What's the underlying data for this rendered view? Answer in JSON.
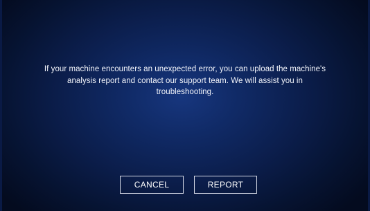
{
  "dialog": {
    "message_lines": [
      "If your machine encounters an unexpected error, you can upload the machine's",
      "analysis report and contact our support team. We will assist you in",
      "troubleshooting."
    ],
    "buttons": {
      "cancel_label": "CANCEL",
      "report_label": "REPORT"
    }
  },
  "colors": {
    "background_center": "#17367e",
    "background_edge": "#040b1f",
    "text": "#f2f4fa",
    "button_border": "#d8dce8"
  }
}
